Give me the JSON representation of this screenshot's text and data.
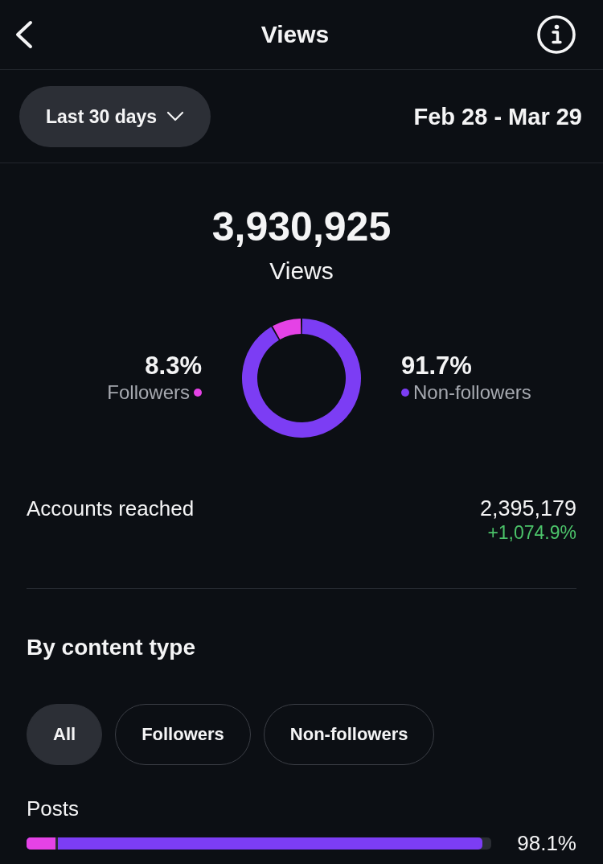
{
  "header": {
    "title": "Views"
  },
  "range": {
    "period": "Last 30 days",
    "dates": "Feb 28 - Mar 29"
  },
  "summary": {
    "total": "3,930,925",
    "label": "Views",
    "chart_data": {
      "type": "donut",
      "values": [
        8.3,
        91.7
      ]
    },
    "legend": [
      {
        "value": "8.3%",
        "label": "Followers",
        "color": "#e542e6"
      },
      {
        "value": "91.7%",
        "label": "Non-followers",
        "color": "#7c3df4"
      }
    ]
  },
  "accounts_reached": {
    "label": "Accounts reached",
    "value": "2,395,179",
    "change": "+1,074.9%"
  },
  "by_content_type": {
    "title": "By content type",
    "filters": [
      {
        "label": "All",
        "selected": true
      },
      {
        "label": "Followers",
        "selected": false
      },
      {
        "label": "Non-followers",
        "selected": false
      }
    ],
    "rows": [
      {
        "label": "Posts",
        "segments": [
          {
            "level": 0.068,
            "color": "#e542e6"
          },
          {
            "level": 0.981,
            "color": "#7c3df4"
          }
        ],
        "value": "98.1%"
      }
    ]
  }
}
